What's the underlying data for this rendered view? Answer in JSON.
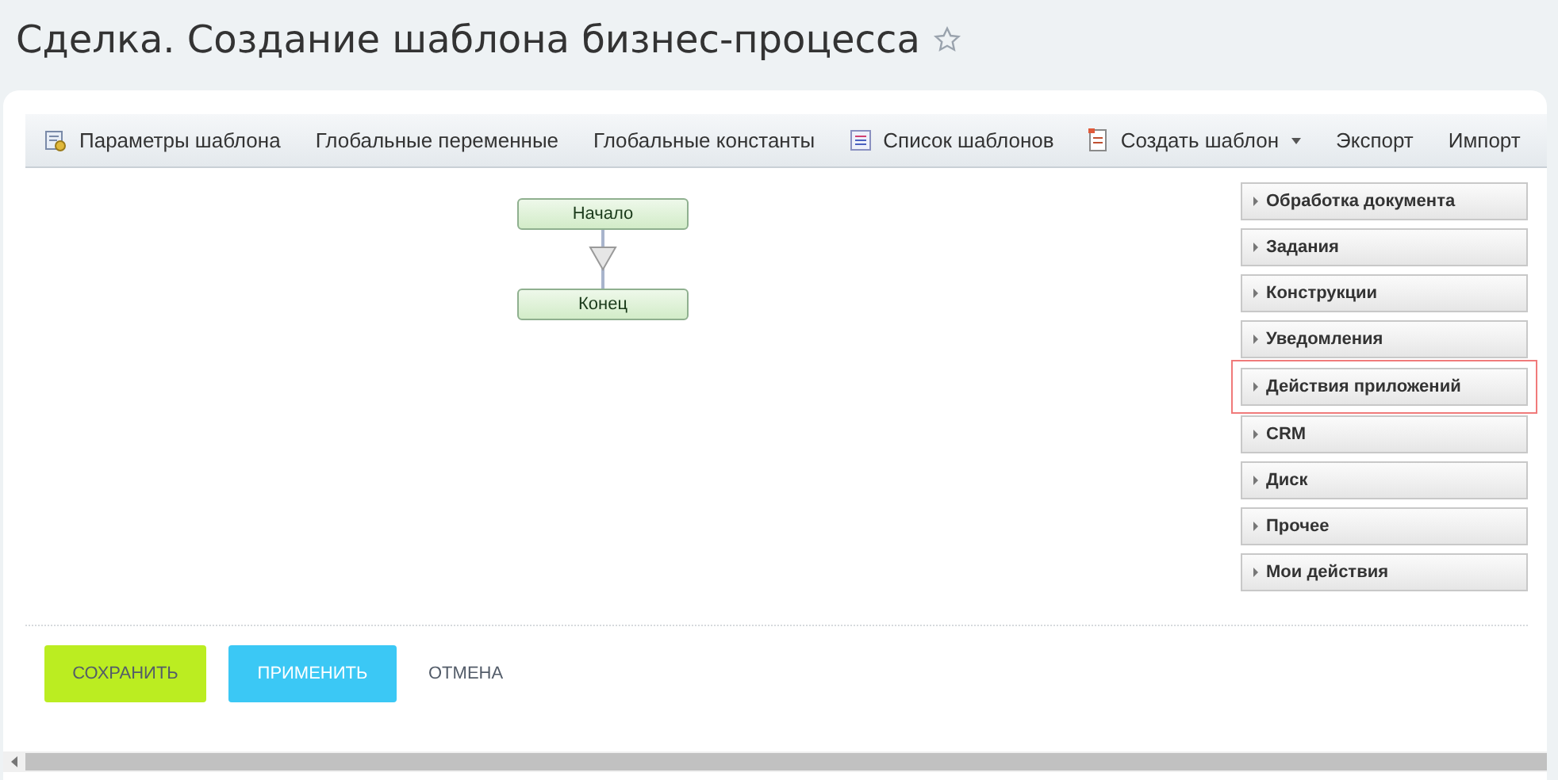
{
  "title": "Сделка. Создание шаблона бизнес-процесса",
  "toolbar": [
    {
      "label": "Параметры шаблона",
      "kind": "settings"
    },
    {
      "label": "Глобальные переменные",
      "kind": "plain"
    },
    {
      "label": "Глобальные константы",
      "kind": "plain"
    },
    {
      "label": "Список шаблонов",
      "kind": "list"
    },
    {
      "label": "Создать шаблон",
      "kind": "menu"
    },
    {
      "label": "Экспорт",
      "kind": "plain"
    },
    {
      "label": "Импорт",
      "kind": "plain"
    }
  ],
  "diagram": {
    "start": "Начало",
    "end": "Конец"
  },
  "groups": [
    {
      "label": "Обработка документа",
      "highlighted": false
    },
    {
      "label": "Задания",
      "highlighted": false
    },
    {
      "label": "Конструкции",
      "highlighted": false
    },
    {
      "label": "Уведомления",
      "highlighted": false
    },
    {
      "label": "Действия приложений",
      "highlighted": true
    },
    {
      "label": "CRM",
      "highlighted": false
    },
    {
      "label": "Диск",
      "highlighted": false
    },
    {
      "label": "Прочее",
      "highlighted": false
    },
    {
      "label": "Мои действия",
      "highlighted": false
    }
  ],
  "buttons": {
    "save": "СОХРАНИТЬ",
    "apply": "ПРИМЕНИТЬ",
    "cancel": "ОТМЕНА"
  }
}
